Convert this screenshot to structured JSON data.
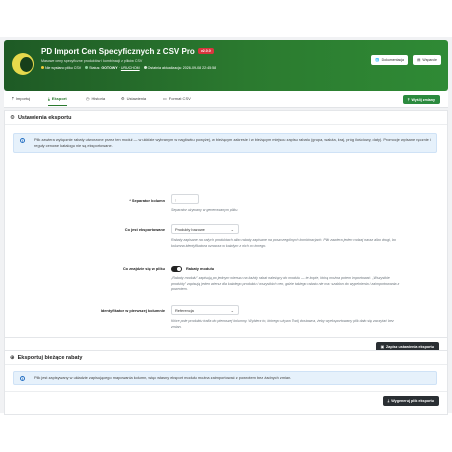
{
  "header": {
    "title": "PD Import Cen Specyficznych z CSV Pro",
    "badge": "v2.0.0",
    "subtitle": "Masowe ceny specyficzne produktów i kombinacji z plików CSV",
    "status_running": "Nie wysłano pliku CSV",
    "status_label_prefix": "Status:",
    "status_value": "GOTOWY",
    "status_link": "URUCHOM",
    "last_update": "Ostatnia aktualizacja: 2026-09-08 22:45:58",
    "btn_docs": "Dokumentacja",
    "btn_contact": "Wsparcie"
  },
  "tabs": [
    {
      "label": "Importuj"
    },
    {
      "label": "Eksport"
    },
    {
      "label": "Historia"
    },
    {
      "label": "Ustawienia"
    },
    {
      "label": "Format CSV"
    }
  ],
  "export_button": "Wyślij zmiany",
  "settings_card": {
    "title": "Ustawienia eksportu",
    "info_text": "Plik zawiera wyłącznie rabaty utworzone przez ten moduł — w ukłdzie wybranym w nagłówku powyżej, w bieżącym zakresie i w bieżącym miejscu zapisu rabatu (grupa, waluta, kraj, próg ilościowy, daty). Promocje wpisane ręcznie i reguły cenowe katalogu nie są eksportowane.",
    "separator_label": "* Separator kolumn",
    "separator_value": ";",
    "separator_help": "Separator używany w generowanym pliku.",
    "what_export_label": "Co jest eksportowane",
    "what_export_value": "Produkty bazowe",
    "what_export_help": "Rabaty zapisane na całych produktach albo rabaty zapisane na poszczególnych kombinacjach. Plik zawiera jeden rodzaj naraz albo drugi, bo kolumna identyfikatora oznacza w każdym z nich co innego.",
    "in_file_label": "Co znajdzie się w pliku",
    "in_file_toggle": "Rabaty modułu",
    "in_file_help": "„Rabaty modułu” zapisują po jednym wierszu na każdy rabat należący do modułu — te kopie, którą można potem importować. „Wszystkie produkty” zapisują jeden wiersz dla każdego produktu i wszystkich cen, gdzie takiego rabatu nie ma: szablon do wypełnienia i zaimportowania z powrotem.",
    "identifier_label": "Identyfikator w pierwszej kolumnie",
    "identifier_value": "Referencja",
    "identifier_help": "Które pole produktu trafia do pierwszej kolumny. Wybierz to, którego używa Twój dostawca, żeby wyeksportowany plik dało się zaczytać bez zmian.",
    "save_button": "Zapisz ustawienia eksportu"
  },
  "export_card": {
    "title": "Eksportuj bieżące rabaty",
    "info_text": "Plik jest zapisywany w układzie zapisującego mapowania kolumn, więc własny eksport modułu można zaimportować z powrotem bez żadnych zmian.",
    "generate_button": "Wygeneruj plik eksportu"
  },
  "colors": {
    "brand": "#2b7a2f",
    "danger": "#d9363e",
    "info_bg": "#e6f1fb",
    "dark": "#2a2f33"
  },
  "icons": [
    "puzzle-icon",
    "globe-icon",
    "book-icon",
    "upload-icon",
    "download-icon",
    "history-icon",
    "settings-icon",
    "file-icon",
    "save-icon",
    "info-icon",
    "gear-icon",
    "export-icon"
  ]
}
